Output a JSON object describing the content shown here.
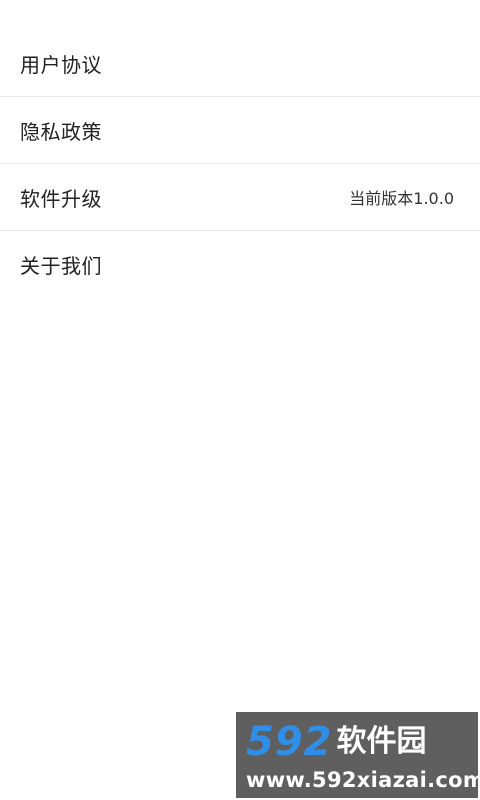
{
  "settings": {
    "items": [
      {
        "label": "用户协议",
        "value": ""
      },
      {
        "label": "隐私政策",
        "value": ""
      },
      {
        "label": "软件升级",
        "value": "当前版本1.0.0"
      },
      {
        "label": "关于我们",
        "value": ""
      }
    ]
  },
  "watermark": {
    "digits": "592",
    "text": "软件园",
    "url": "www.592xiazai.com",
    "accent_color": "#2f8fe8"
  }
}
